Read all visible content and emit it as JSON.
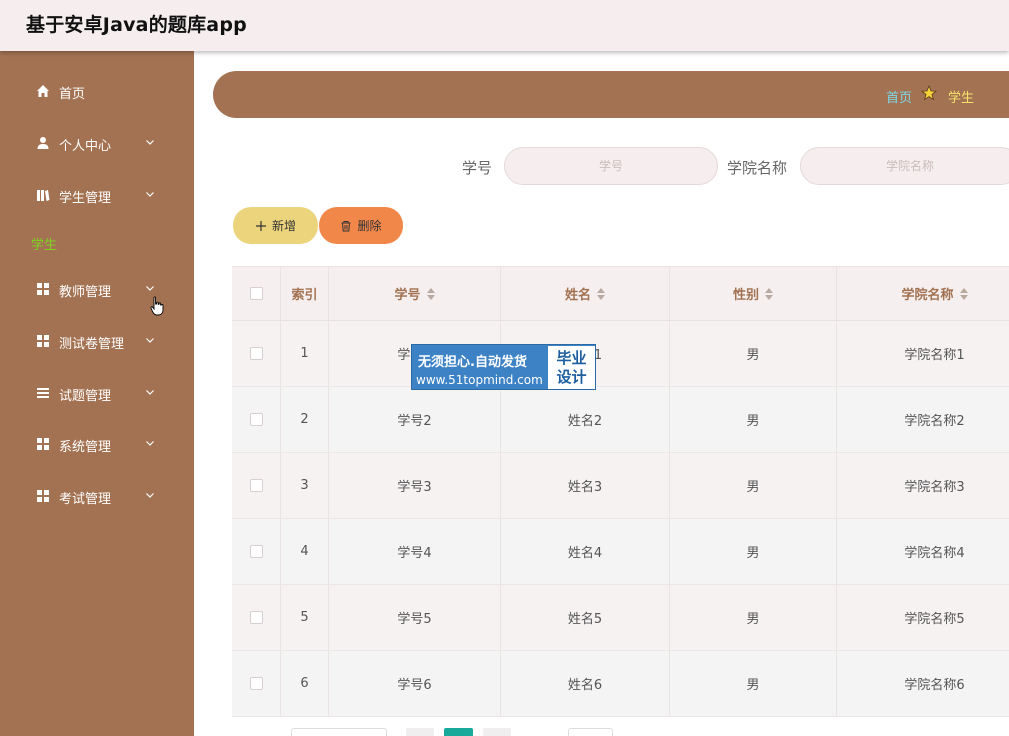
{
  "header": {
    "title": "基于安卓Java的题库app"
  },
  "sidebar": {
    "items": [
      {
        "label": "首页",
        "icon": "home-icon"
      },
      {
        "label": "个人中心",
        "icon": "user-icon"
      },
      {
        "label": "学生管理",
        "icon": "book-icon"
      },
      {
        "label": "教师管理",
        "icon": "grid-icon"
      },
      {
        "label": "测试卷管理",
        "icon": "grid-icon"
      },
      {
        "label": "试题管理",
        "icon": "list-icon"
      },
      {
        "label": "系统管理",
        "icon": "grid-icon"
      },
      {
        "label": "考试管理",
        "icon": "grid-icon"
      }
    ],
    "submenu_active": "学生"
  },
  "breadcrumb": {
    "home": "首页",
    "current": "学生"
  },
  "search": {
    "student_id_label": "学号",
    "student_id_placeholder": "学号",
    "college_label": "学院名称",
    "college_placeholder": "学院名称"
  },
  "toolbar": {
    "add_label": "新增",
    "delete_label": "删除"
  },
  "table": {
    "columns": [
      "索引",
      "学号",
      "姓名",
      "性别",
      "学院名称"
    ],
    "rows": [
      {
        "index": "1",
        "student_id": "学号1",
        "name": "姓名1",
        "gender": "男",
        "college": "学院名称1"
      },
      {
        "index": "2",
        "student_id": "学号2",
        "name": "姓名2",
        "gender": "男",
        "college": "学院名称2"
      },
      {
        "index": "3",
        "student_id": "学号3",
        "name": "姓名3",
        "gender": "男",
        "college": "学院名称3"
      },
      {
        "index": "4",
        "student_id": "学号4",
        "name": "姓名4",
        "gender": "男",
        "college": "学院名称4"
      },
      {
        "index": "5",
        "student_id": "学号5",
        "name": "姓名5",
        "gender": "男",
        "college": "学院名称5"
      },
      {
        "index": "6",
        "student_id": "学号6",
        "name": "姓名6",
        "gender": "男",
        "college": "学院名称6"
      }
    ]
  },
  "watermark": {
    "line1": "无须担心.自动发货",
    "line2": "www.51topmind.com",
    "box_line1": "毕业",
    "box_line2": "设计"
  },
  "colors": {
    "sidebar": "#a37252",
    "accent_add": "#ecd47d",
    "accent_delete": "#f2874a",
    "pager_active": "#19a99b"
  }
}
